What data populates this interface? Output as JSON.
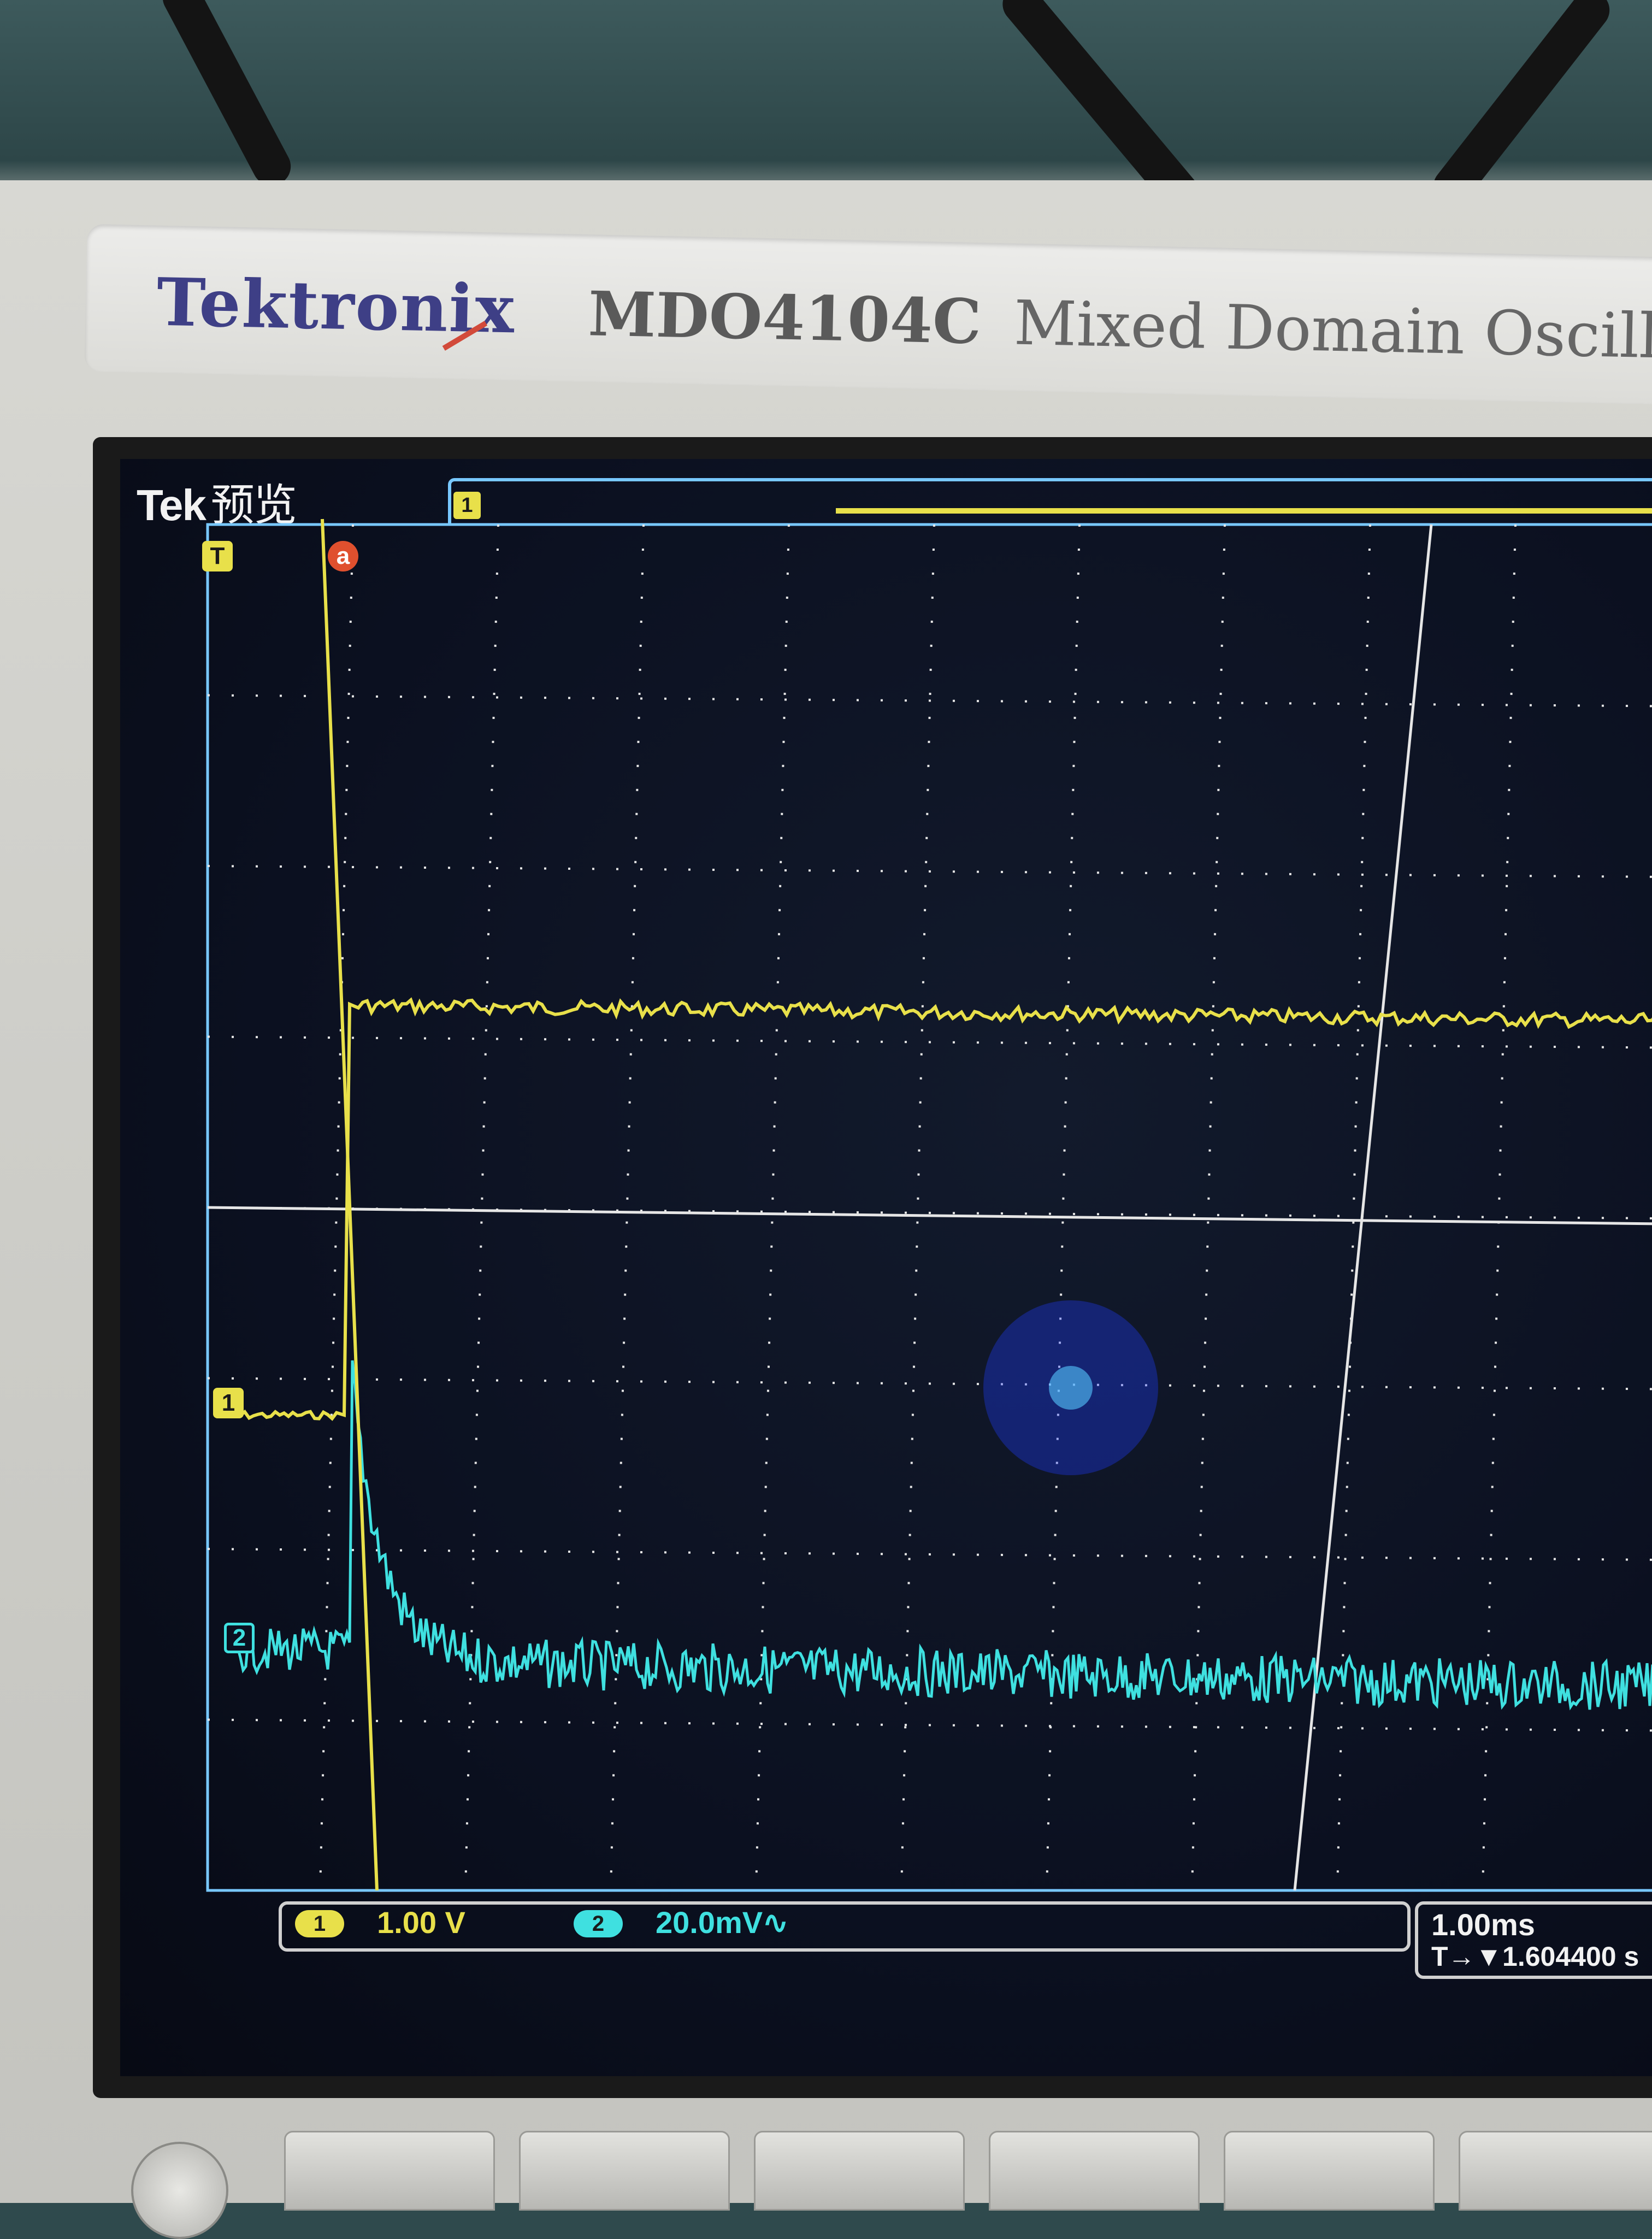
{
  "brand": {
    "name": "Tektronix",
    "model": "MDO4104C",
    "description": "Mixed Domain Oscillo"
  },
  "screen": {
    "logo": "Tek",
    "mode": "预览",
    "trigger_marker": "T",
    "cursor_marker": "a",
    "ch1_marker": "1",
    "ch2_marker": "2",
    "ch1_label": "1",
    "ch1_scale": "1.00 V",
    "ch2_label": "2",
    "ch2_scale": "20.0mV∿",
    "time_scale": "1.00ms",
    "trigger_readout": "T→▼1.604400 s",
    "topbar_marker": "1"
  },
  "colors": {
    "ch1": "#e8e04a",
    "ch2": "#3fe0e0",
    "grid": "#e6e6e6",
    "axes": "#78c8ff"
  }
}
